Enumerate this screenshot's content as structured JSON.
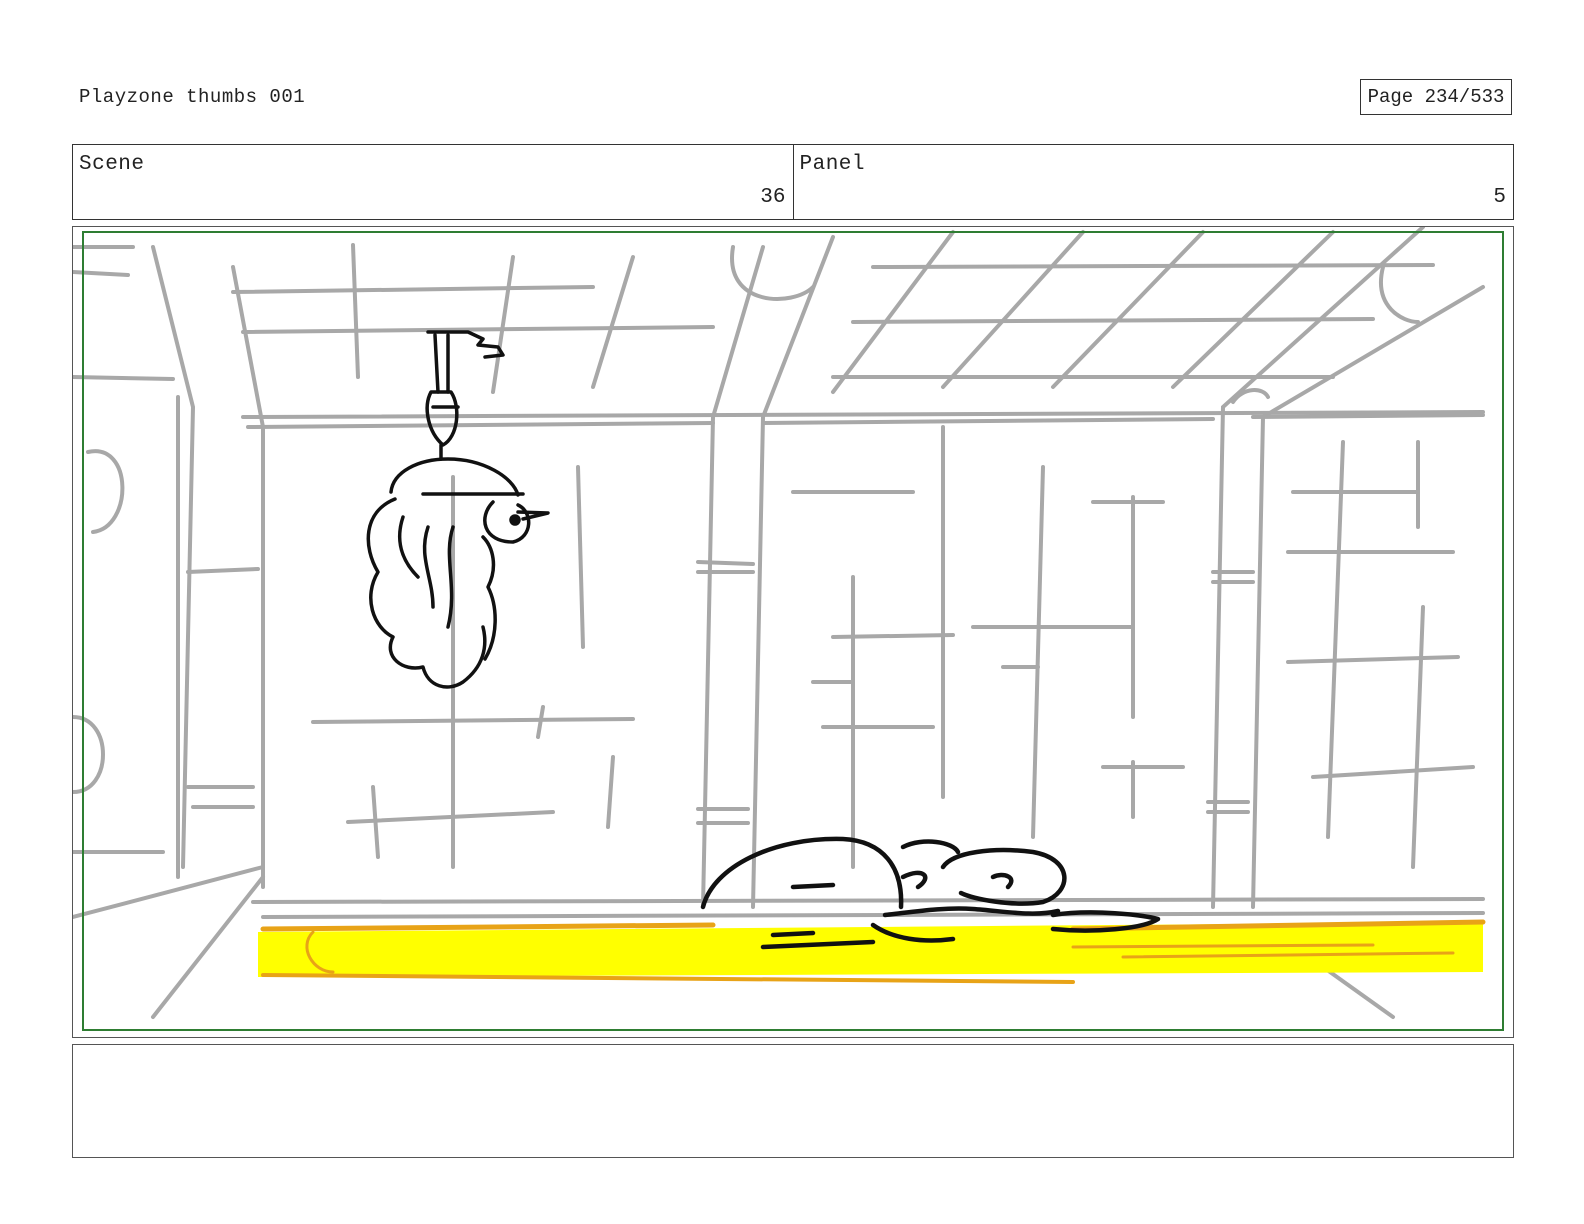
{
  "header": {
    "title": "Playzone thumbs 001",
    "page_label": "Page 234/533"
  },
  "fields": {
    "scene_label": "Scene",
    "scene_value": "36",
    "panel_label": "Panel",
    "panel_value": "5"
  },
  "colors": {
    "frame_guide": "#2e7d32",
    "sketch_gray": "#a8a8a8",
    "ink": "#111111",
    "highlight_yellow": "#ffff00",
    "highlight_orange": "#e8a317"
  },
  "notes": {
    "text": ""
  }
}
